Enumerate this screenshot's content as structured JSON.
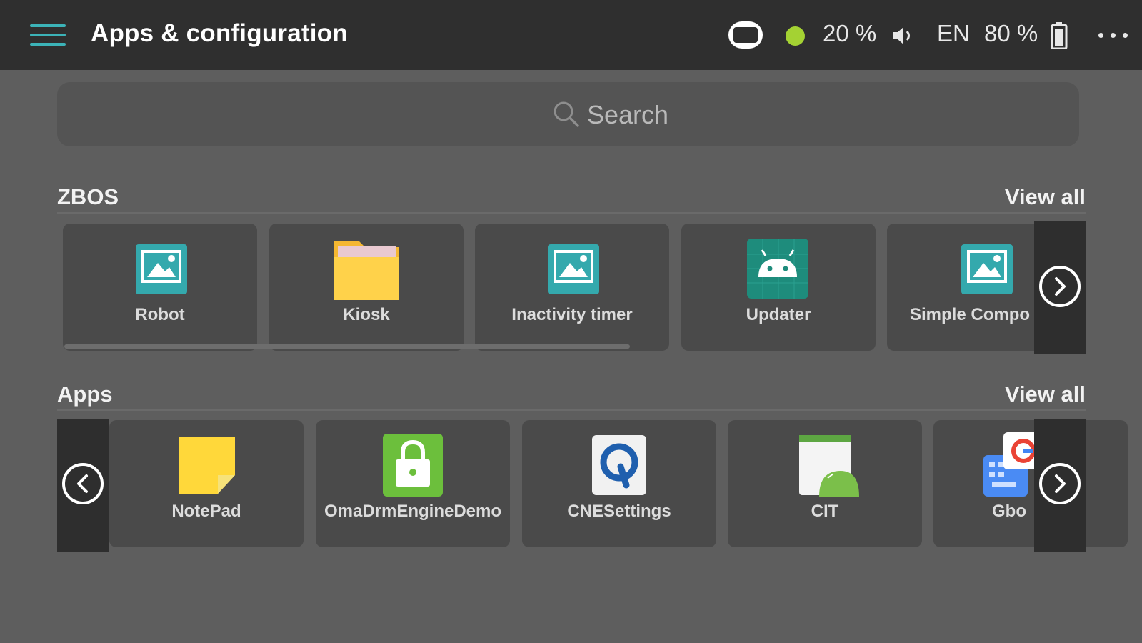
{
  "header": {
    "title": "Apps & configuration",
    "volume_percent": "20 %",
    "language": "EN",
    "battery_percent": "80 %",
    "status_dot_color": "#a4d233",
    "accent_color": "#3cb3b8"
  },
  "search": {
    "placeholder": "Search"
  },
  "sections": {
    "zbos": {
      "title": "ZBOS",
      "view_all": "View all",
      "items": [
        {
          "label": "Robot",
          "icon": "image-placeholder-icon"
        },
        {
          "label": "Kiosk",
          "icon": "folder-icon"
        },
        {
          "label": "Inactivity timer",
          "icon": "image-placeholder-icon"
        },
        {
          "label": "Updater",
          "icon": "android-robot-icon"
        },
        {
          "label": "Simple Compo",
          "icon": "image-placeholder-icon"
        }
      ]
    },
    "apps": {
      "title": "Apps",
      "view_all": "View all",
      "items": [
        {
          "label": "NotePad",
          "icon": "sticky-note-icon"
        },
        {
          "label": "OmaDrmEngineDemo",
          "icon": "lock-icon"
        },
        {
          "label": "CNESettings",
          "icon": "qualcomm-q-icon"
        },
        {
          "label": "CIT",
          "icon": "android-cit-icon"
        },
        {
          "label": "Gbo",
          "icon": "gboard-icon"
        }
      ]
    }
  }
}
